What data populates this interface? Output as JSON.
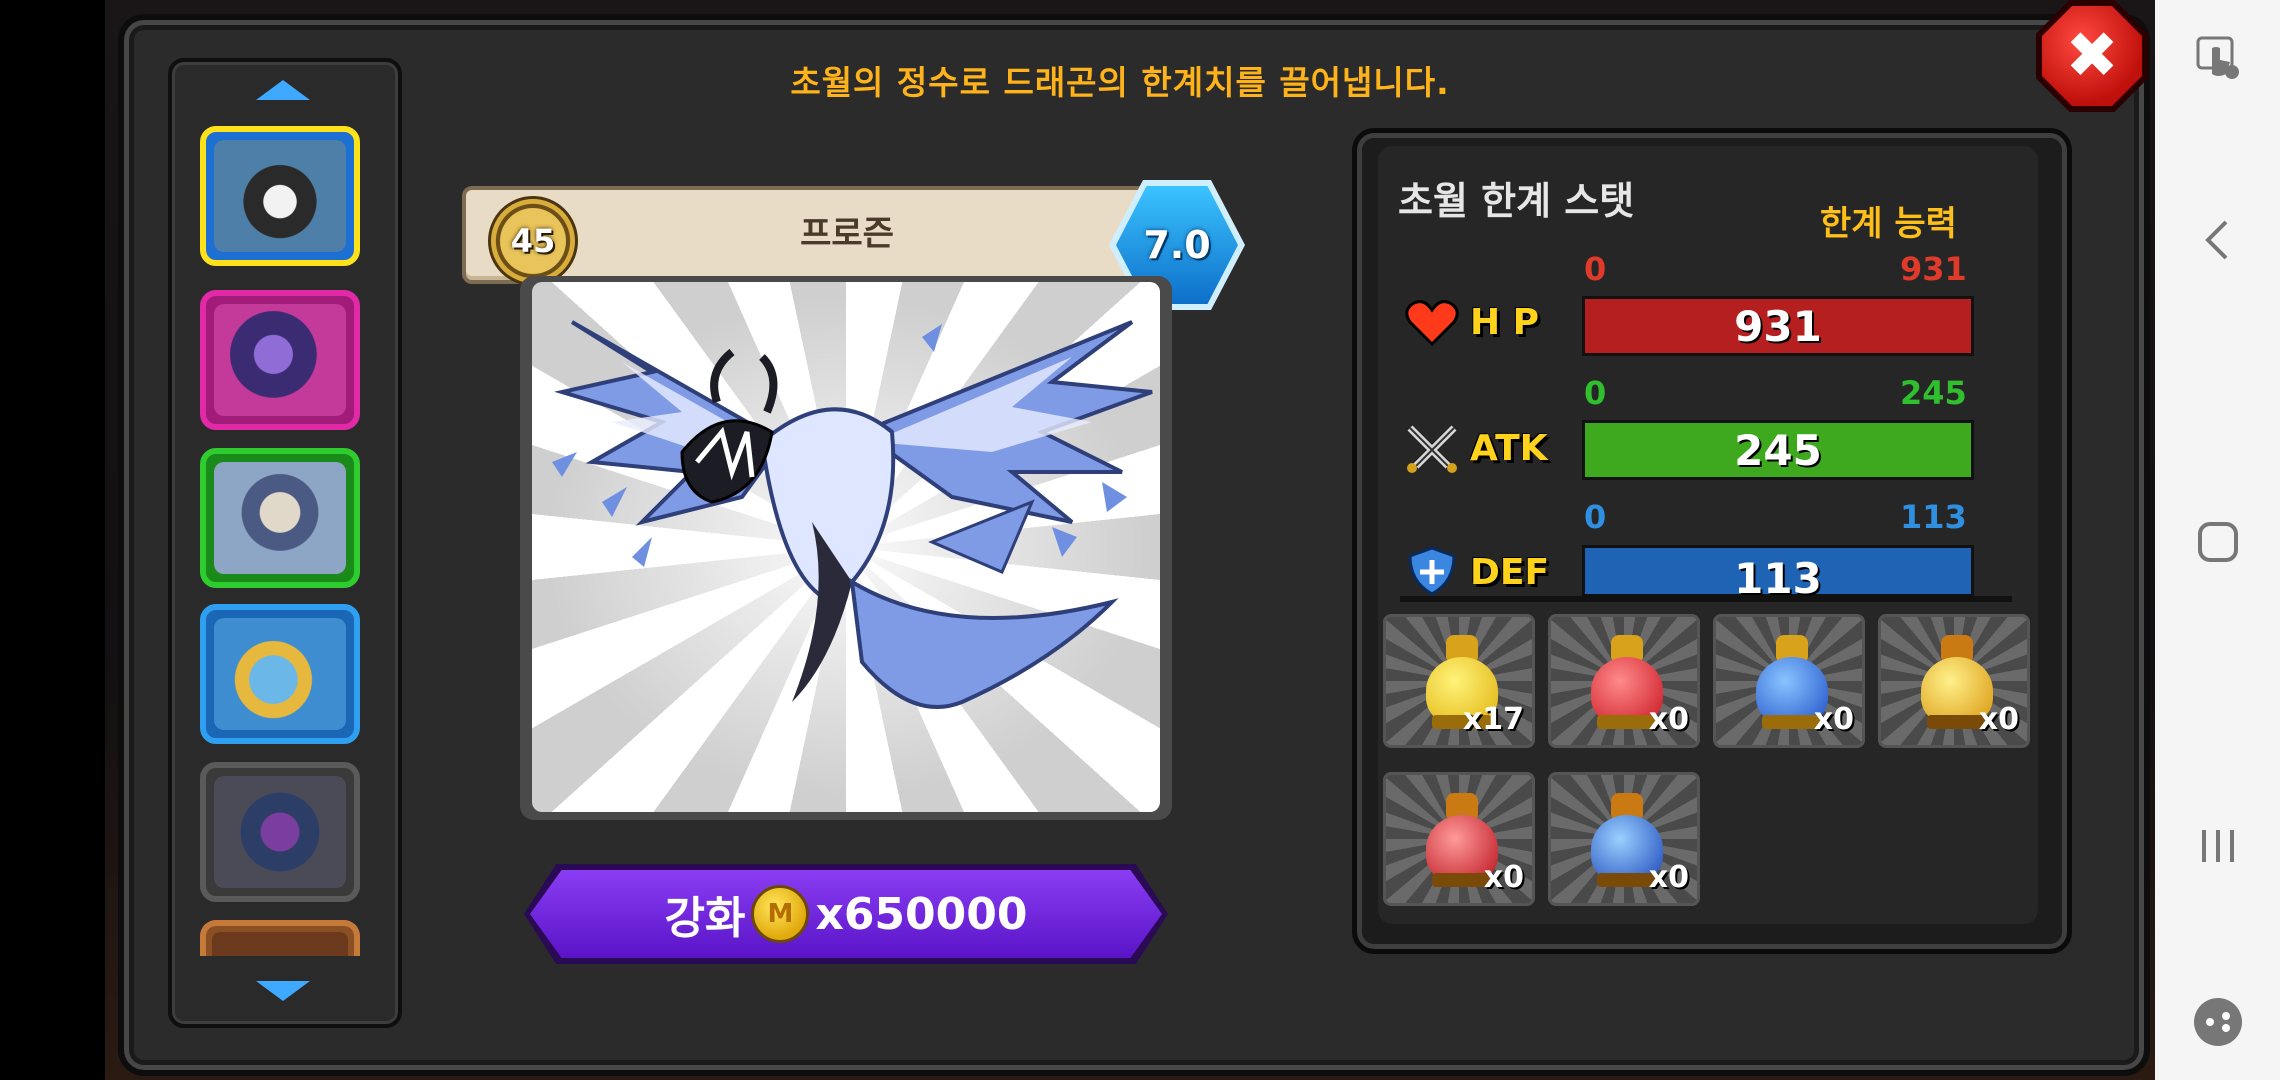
{
  "description": "초월의 정수로 드래곤의 한계치를 끌어냅니다.",
  "dragon": {
    "name": "프로즌",
    "level": "45",
    "grade": "7.0"
  },
  "upgrade": {
    "label": "강화",
    "coin_letter": "M",
    "cost": "x650000"
  },
  "stats_panel": {
    "title": "초월 한계 스탯",
    "limit_label": "한계 능력",
    "stats": [
      {
        "label": "H P",
        "min": "0",
        "max": "931",
        "value": "931",
        "color": "#b51f1f",
        "range_color": "#e03a2a"
      },
      {
        "label": "ATK",
        "min": "0",
        "max": "245",
        "value": "245",
        "color": "#3ea81f",
        "range_color": "#2fbf2f"
      },
      {
        "label": "DEF",
        "min": "0",
        "max": "113",
        "value": "113",
        "color": "#1f63b5",
        "range_color": "#2f8fe0"
      }
    ]
  },
  "items": [
    {
      "count": "x17",
      "color": "yellow"
    },
    {
      "count": "x0",
      "color": "red"
    },
    {
      "count": "x0",
      "color": "blue"
    },
    {
      "count": "x0",
      "color": "gold"
    },
    {
      "count": "x0",
      "color": "red-gold"
    },
    {
      "count": "x0",
      "color": "blue-gold"
    }
  ],
  "close_symbol": "✖"
}
